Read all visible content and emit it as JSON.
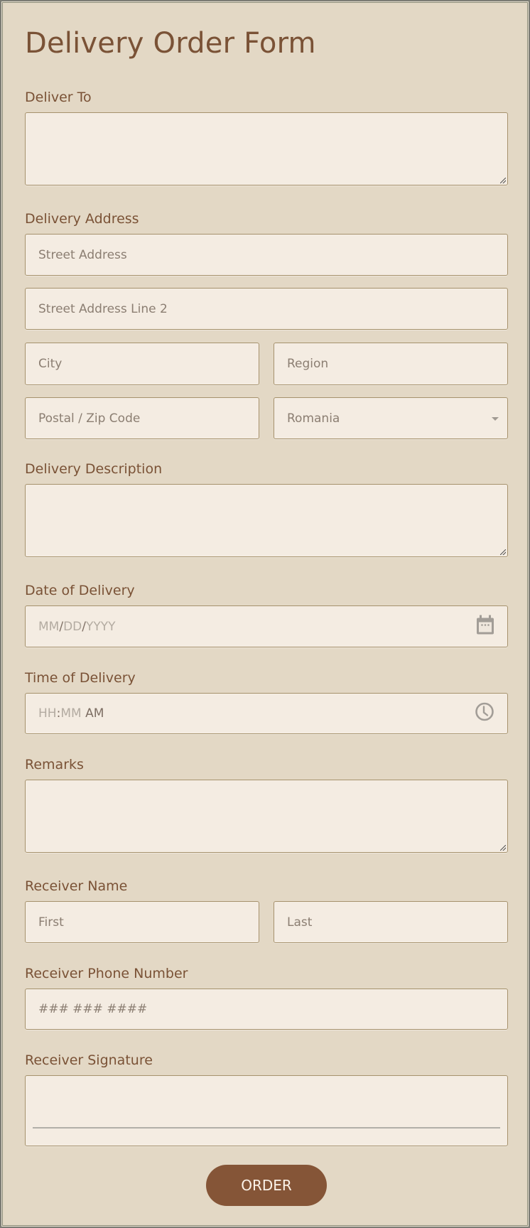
{
  "form": {
    "title": "Delivery Order Form",
    "deliver_to": {
      "label": "Deliver To",
      "value": ""
    },
    "delivery_address": {
      "label": "Delivery Address",
      "street_placeholder": "Street Address",
      "street2_placeholder": "Street Address Line 2",
      "city_placeholder": "City",
      "region_placeholder": "Region",
      "postal_placeholder": "Postal / Zip Code",
      "country_selected": "Romania"
    },
    "delivery_description": {
      "label": "Delivery Description",
      "value": ""
    },
    "date_of_delivery": {
      "label": "Date of Delivery",
      "mm": "MM",
      "sep1": "/",
      "dd": "DD",
      "sep2": "/",
      "yyyy": "YYYY",
      "icon": "calendar-icon"
    },
    "time_of_delivery": {
      "label": "Time of Delivery",
      "hh": "HH",
      "sep": ":",
      "mm": "MM",
      "ampm": "AM",
      "icon": "clock-icon"
    },
    "remarks": {
      "label": "Remarks",
      "value": ""
    },
    "receiver_name": {
      "label": "Receiver Name",
      "first_placeholder": "First",
      "last_placeholder": "Last"
    },
    "receiver_phone": {
      "label": "Receiver Phone Number",
      "placeholder": "### ### ####"
    },
    "receiver_signature": {
      "label": "Receiver Signature"
    },
    "submit_label": "ORDER"
  },
  "colors": {
    "background": "#e3d8c5",
    "field_bg": "#f4ece2",
    "accent": "#855537",
    "label_text": "#7a5236"
  }
}
